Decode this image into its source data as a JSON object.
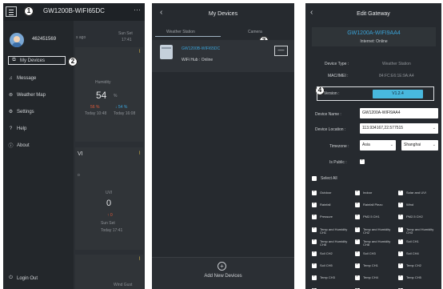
{
  "screen1": {
    "title": "GW1200B-WIFI65DC",
    "more_icon": "ellipsis-icon",
    "callout_1": "1",
    "callout_2": "2",
    "username": "462451569",
    "menu": [
      {
        "icon": "devices-icon",
        "label": "My Devices"
      },
      {
        "icon": "bell-icon",
        "label": "Message"
      },
      {
        "icon": "map-icon",
        "label": "Weather Map"
      },
      {
        "icon": "gear-icon",
        "label": "Settings"
      },
      {
        "icon": "help-icon",
        "label": "Help"
      },
      {
        "icon": "info-icon",
        "label": "About"
      }
    ],
    "logout": {
      "icon": "power-icon",
      "label": "Login Out"
    },
    "background": {
      "ago": "s ago",
      "sunset": "Sun Set",
      "sunset_time": "17:41",
      "humidity_label": "Humidity",
      "humidity": "54",
      "humidity_unit": "%",
      "hi": "56 %",
      "lo": "↓ 54 %",
      "hi_time": "Today 10:48",
      "lo_time": "Today 16:08",
      "vi": "VI",
      "o": "o",
      "uvi": "UVI",
      "uvi_val": "0",
      "uvi_sub": "↑ 0",
      "sunset2": "Sun Set",
      "today": "Today 17:41",
      "wind": "Wind Gust"
    }
  },
  "screen2": {
    "title": "My Devices",
    "back_icon": "back-arrow-icon",
    "tabs": [
      "Weather Station",
      "Camera"
    ],
    "callout_3": "3",
    "device": {
      "name": "GW1200B-WIFI65DC",
      "status": "WiFi Hub : Online"
    },
    "remove_label": "—",
    "add_label": "Add New Devices"
  },
  "screen3": {
    "title": "Edit Gateway",
    "back_icon": "back-arrow-icon",
    "gateway": {
      "name": "GW1200A-WIFI9AA4",
      "status": "Internet: Online"
    },
    "device_type_label": "Device Type :",
    "device_type_value": "Weather Station",
    "mac_label": "MAC/IMEI :",
    "mac_value": "84:FC:E6:1E:9A:A4",
    "callout_4": "4",
    "version_label": "Version :",
    "version_value": "V1.2.4",
    "device_name_label": "Device Name :",
    "device_name_value": "GW1200A-WIFI9AA4",
    "device_location_label": "Device Location :",
    "device_location_value": "113.934167,22.577515",
    "timezone_label": "Timezone :",
    "timezone_region": "Asia",
    "timezone_city": "Shanghai",
    "is_public_label": "Is Public :",
    "select_all_label": "Select All",
    "sensors": [
      "Outdoor",
      "Indoor",
      "Solar and UVI",
      "Rainfall",
      "Rainfall Piezo",
      "Wind",
      "Pressure",
      "PM2.5 CH1",
      "PM2.5 CH2",
      "Temp and Humidity CH1",
      "Temp and Humidity CH2",
      "Temp and Humidity CH3",
      "Temp and Humidity CH8",
      "Temp and Humidity CH8",
      "Soil CH1",
      "Soil CH2",
      "Soil CH3",
      "Soil CH4",
      "Soil CH5",
      "Temp CH1",
      "Temp CH2",
      "Temp CH3",
      "Temp CH4",
      "Temp CH5",
      "Temp CH6",
      "Temp CH7",
      ""
    ]
  }
}
